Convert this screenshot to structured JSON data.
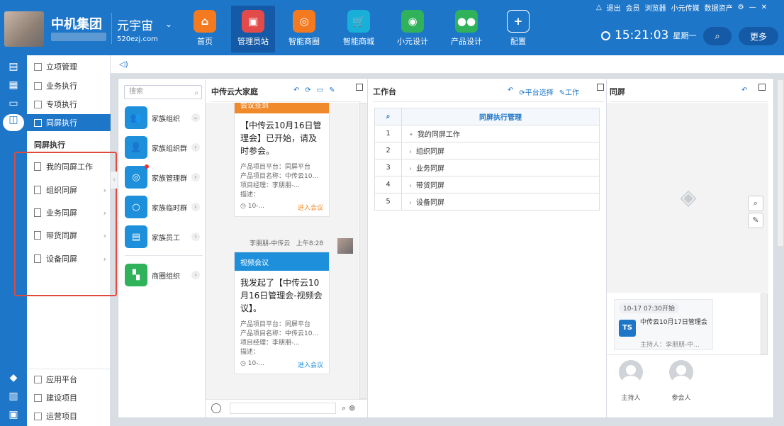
{
  "header": {
    "brand": "中机集团",
    "product": "元宇宙",
    "url": "520ezj.com",
    "nav": [
      {
        "label": "首页",
        "icon": "home-icon",
        "color": "#f47a20"
      },
      {
        "label": "管理员站",
        "icon": "monitor-icon",
        "color": "#e34b4b"
      },
      {
        "label": "智能商圈",
        "icon": "circle-icon",
        "color": "#f47a20"
      },
      {
        "label": "智能商城",
        "icon": "cart-icon",
        "color": "#18b0d8"
      },
      {
        "label": "小元设计",
        "icon": "globe-icon",
        "color": "#2fb25a"
      },
      {
        "label": "产品设计",
        "icon": "people-icon",
        "color": "#2fb25a"
      },
      {
        "label": "配置",
        "icon": "plus-icon",
        "color": "#1e76c9"
      }
    ],
    "top_links": [
      "退出",
      "会员",
      "浏览器",
      "小元传媒",
      "数据资产"
    ],
    "time": "15:21:03",
    "weekday": "星期一",
    "more": "更多"
  },
  "menu": {
    "top_items": [
      "立项管理",
      "业务执行",
      "专项执行",
      "同屏执行"
    ],
    "section_title": "同屏执行",
    "sub_items": [
      "我的同屏工作",
      "组织同屏",
      "业务同屏",
      "带货同屏",
      "设备同屏"
    ],
    "bottom_items": [
      "应用平台",
      "建设项目",
      "运营项目"
    ]
  },
  "contacts": {
    "search_placeholder": "搜索",
    "groups": [
      {
        "label": "家族组织",
        "color": "#1e8fdb"
      },
      {
        "label": "家族组织群",
        "color": "#1e8fdb"
      },
      {
        "label": "家族管理群",
        "color": "#1e8fdb"
      },
      {
        "label": "家族临时群",
        "color": "#1e8fdb"
      },
      {
        "label": "家族员工",
        "color": "#1e8fdb"
      },
      {
        "label": "商圈组织",
        "color": "#2fb25a"
      }
    ]
  },
  "chat": {
    "title": "中传云大家庭",
    "card1": {
      "header": "会议签到",
      "body": "【中传云10月16日管理会】已开始，请及时参会。",
      "meta": [
        "产品项目平台：同屏平台",
        "产品项目名称：中传云10...",
        "项目经理：李朋朋-...",
        "描述："
      ],
      "time": "10-...",
      "action": "进入会议"
    },
    "sender": "李朋朋-中传云",
    "send_time": "上午8:28",
    "card2": {
      "header": "视频会议",
      "body": "我发起了【中传云10月16日管理会-视频会议】。",
      "meta": [
        "产品项目平台：同屏平台",
        "产品项目名称：中传云10...",
        "项目经理：李朋朋-...",
        "描述："
      ],
      "time": "10-...",
      "action": "进入会议"
    }
  },
  "workbench": {
    "title": "工作台",
    "tools": [
      "平台选择",
      "工作"
    ],
    "table_header": "同屏执行管理",
    "rows": [
      {
        "n": "1",
        "label": "我的同屏工作",
        "mark": "•"
      },
      {
        "n": "2",
        "label": "组织同屏",
        "mark": "›"
      },
      {
        "n": "3",
        "label": "业务同屏",
        "mark": "›"
      },
      {
        "n": "4",
        "label": "带货同屏",
        "mark": "›"
      },
      {
        "n": "5",
        "label": "设备同屏",
        "mark": "›"
      }
    ]
  },
  "screen": {
    "title": "同屏",
    "meeting_time": "10-17 07:30开始",
    "meeting_title": "中传云10月17日管理会",
    "host_line": "主持人：李朋朋-中...",
    "host": "主持人",
    "attendee": "参会人"
  }
}
